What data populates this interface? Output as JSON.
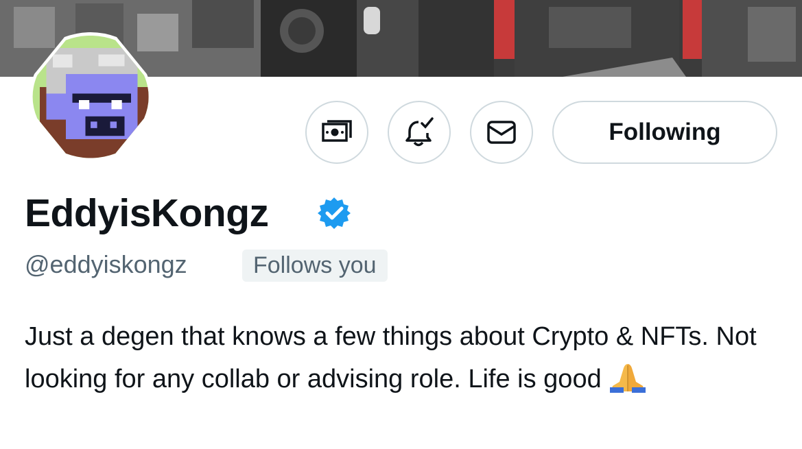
{
  "profile": {
    "display_name": "EddyisKongz",
    "handle": "@eddyiskongz",
    "follows_you_badge": "Follows you",
    "verified": true,
    "bio": "Just a degen that knows a few things about Crypto & NFTs. Not looking for any collab or advising role. Life is good",
    "bio_emoji": "pray-hands-emoji"
  },
  "actions": {
    "tip_icon": "money-icon",
    "notify_icon": "bell-check-icon",
    "message_icon": "envelope-icon",
    "follow_label": "Following"
  },
  "colors": {
    "verified_blue": "#1d9bf0",
    "secondary_text": "#536471",
    "border": "#cfd9de",
    "badge_bg": "#eff3f4",
    "avatar_face": "#8b87f0",
    "avatar_bg": "#b9e38a"
  }
}
